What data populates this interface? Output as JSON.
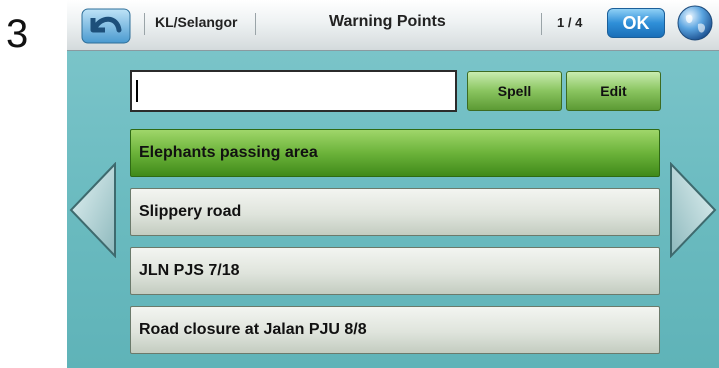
{
  "step_number": "3",
  "header": {
    "region": "KL/Selangor",
    "title": "Warning Points",
    "page_indicator": "1 / 4",
    "ok_label": "OK"
  },
  "search": {
    "value": ""
  },
  "buttons": {
    "spell_label": "Spell",
    "edit_label": "Edit"
  },
  "list": {
    "items": [
      {
        "label": "Elephants passing area",
        "selected": true
      },
      {
        "label": "Slippery road",
        "selected": false
      },
      {
        "label": "JLN PJS 7/18",
        "selected": false
      },
      {
        "label": "Road closure at Jalan PJU 8/8",
        "selected": false
      }
    ]
  },
  "icons": {
    "back": "back-arrow-icon",
    "globe": "globe-icon",
    "prev": "left-arrow-icon",
    "next": "right-arrow-icon"
  },
  "colors": {
    "background": "#6bbbc0",
    "selected_item": "#6cb33a",
    "ok_button": "#2f8fd8",
    "action_button": "#89c45f"
  }
}
